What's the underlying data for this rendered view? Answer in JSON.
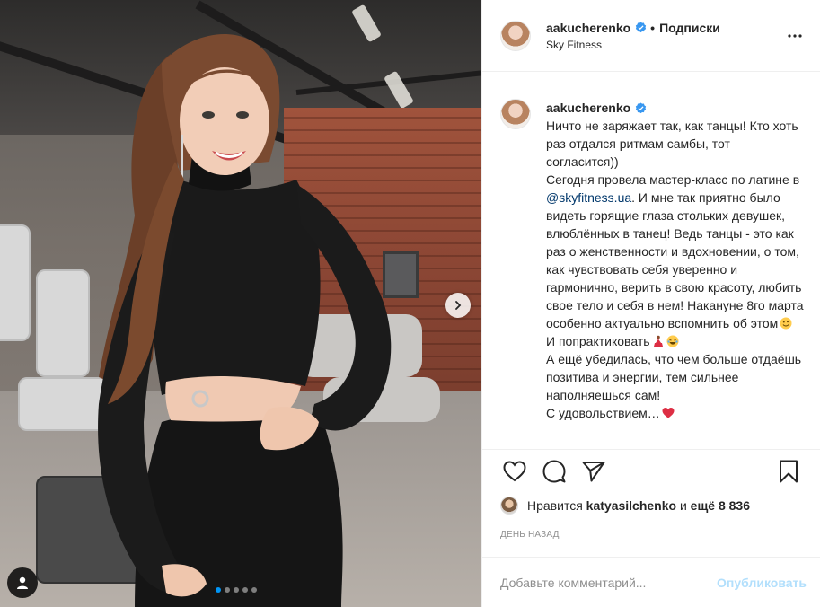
{
  "post": {
    "username": "aakucherenko",
    "follow_separator": "•",
    "follow_label": "Подписки",
    "location": "Sky Fitness",
    "more_icon": "more-horizontal-icon"
  },
  "caption": {
    "username": "aakucherenko",
    "text_1": "Ничто не заряжает так, как танцы! Кто хоть раз отдался ритмам самбы, тот согласится))",
    "text_2_before": "Сегодня провела мастер-класс по латине в ",
    "mention": "@skyfitness.ua",
    "text_2_after": ". И мне так приятно было видеть горящие глаза стольких девушек, влюблённых в танец! Ведь танцы - это как раз о женственности и вдохновении, о том, как чувствовать себя уверенно и гармонично, верить в свою красоту, любить свое тело и себя в нем! Накануне 8го марта особенно актуально вспомнить об этом",
    "text_3": "И попрактиковать",
    "text_4": "А ещё убедилась, что чем больше отдаёшь позитива и энергии, тем сильнее наполняешься сам!",
    "text_5": "С удовольствием…"
  },
  "likes": {
    "prefix": "Нравится",
    "user": "katyasilchenko",
    "joiner": "и",
    "rest": "ещё 8 836"
  },
  "date": "ДЕНЬ НАЗАД",
  "comment": {
    "placeholder": "Добавьте комментарий...",
    "publish_label": "Опубликовать"
  },
  "carousel": {
    "slides": 5,
    "active_index": 0
  },
  "colors": {
    "verified": "#3897f0",
    "mention": "#00376b",
    "publish_disabled": "#b2dffc",
    "active_dot": "#0095f6"
  }
}
